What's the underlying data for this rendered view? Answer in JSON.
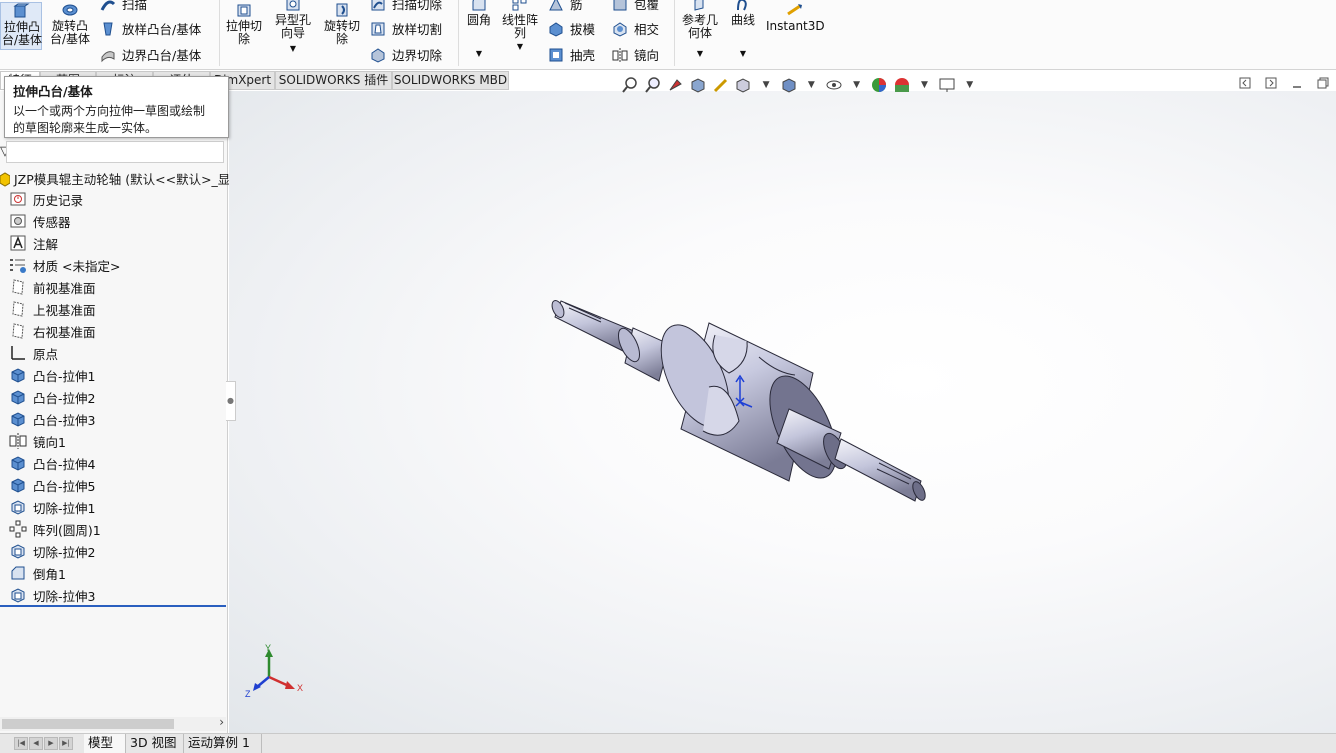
{
  "ribbon": {
    "extrude_boss": "拉伸凸台/基体",
    "revolve_boss": "旋转凸台/基体",
    "sweep": "扫描",
    "loft_boss": "放样凸台/基体",
    "boundary_boss": "边界凸台/基体",
    "extrude_cut": "拉伸切除",
    "hole_wizard": "异型孔向导",
    "revolve_cut": "旋转切除",
    "sweep_cut": "扫描切除",
    "loft_cut": "放样切割",
    "boundary_cut": "边界切除",
    "fillet": "圆角",
    "linear_pattern": "线性阵列",
    "rib": "筋",
    "draft": "拔模",
    "shell": "抽壳",
    "wrap": "包覆",
    "intersect": "相交",
    "mirror": "镜向",
    "ref_geometry": "参考几何体",
    "curves": "曲线",
    "instant3d": "Instant3D"
  },
  "command_tabs": [
    "特征",
    "草图",
    "标注",
    "评估",
    "DimXpert",
    "SOLIDWORKS 插件",
    "SOLIDWORKS MBD"
  ],
  "tooltip": {
    "title": "拉伸凸台/基体",
    "line1": "以一个或两个方向拉伸一草图或绘制",
    "line2": "的草图轮廓来生成一实体。"
  },
  "tree": {
    "root": "JZP模具辊主动轮轴 (默认<<默认>_显示",
    "items": [
      {
        "label": "历史记录",
        "icon": "history-icon"
      },
      {
        "label": "传感器",
        "icon": "sensor-icon"
      },
      {
        "label": "注解",
        "icon": "annotation-icon"
      },
      {
        "label": "材质 <未指定>",
        "icon": "material-icon"
      },
      {
        "label": "前视基准面",
        "icon": "plane-icon"
      },
      {
        "label": "上视基准面",
        "icon": "plane-icon"
      },
      {
        "label": "右视基准面",
        "icon": "plane-icon"
      },
      {
        "label": "原点",
        "icon": "origin-icon"
      },
      {
        "label": "凸台-拉伸1",
        "icon": "boss-extrude-icon"
      },
      {
        "label": "凸台-拉伸2",
        "icon": "boss-extrude-icon"
      },
      {
        "label": "凸台-拉伸3",
        "icon": "boss-extrude-icon"
      },
      {
        "label": "镜向1",
        "icon": "mirror-icon"
      },
      {
        "label": "凸台-拉伸4",
        "icon": "boss-extrude-icon"
      },
      {
        "label": "凸台-拉伸5",
        "icon": "boss-extrude-icon"
      },
      {
        "label": "切除-拉伸1",
        "icon": "cut-extrude-icon"
      },
      {
        "label": "阵列(圆周)1",
        "icon": "circular-pattern-icon"
      },
      {
        "label": "切除-拉伸2",
        "icon": "cut-extrude-icon"
      },
      {
        "label": "倒角1",
        "icon": "chamfer-icon"
      },
      {
        "label": "切除-拉伸3",
        "icon": "cut-extrude-icon"
      }
    ]
  },
  "triad": {
    "x": "X",
    "y": "Y",
    "z": "Z"
  },
  "bottom_tabs": [
    "模型",
    "3D 视图",
    "运动算例 1"
  ],
  "colors": {
    "accent": "#2a5fbf",
    "part": "#c9cbe0",
    "part_dark": "#6e6f86"
  }
}
